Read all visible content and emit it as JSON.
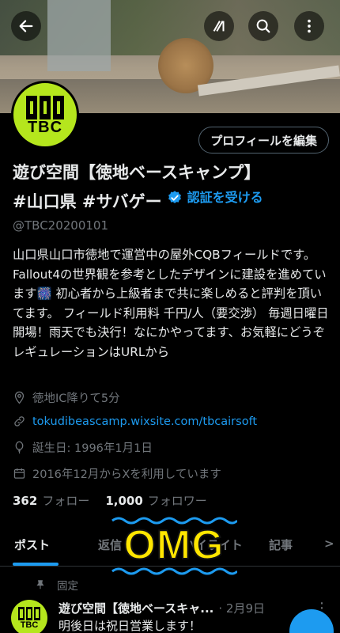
{
  "header": {
    "back_icon": "arrow-left-icon",
    "grok_icon": "grok-icon",
    "search_icon": "search-icon",
    "more_icon": "more-vertical-icon"
  },
  "profile": {
    "avatar_text": "TBC",
    "edit_label": "プロフィールを編集",
    "name_line1": "遊び空間【徳地ベースキャンプ】",
    "name_line2": "#山口県 #サバゲー",
    "verify_label": "認証を受ける",
    "handle": "@TBC20200101",
    "bio": "山口県山口市徳地で運営中の屋外CQBフィールドです。 Fallout4の世界観を参考としたデザインに建設を進めています🎆 初心者から上級者まで共に楽しめると評判を頂いてます。 フィールド利用料 千円/人（要交渉） 毎週日曜日開場！雨天でも決行！なにかやってます、お気軽にどうぞ レギュレーションはURLから",
    "location": "徳地IC降りて5分",
    "website": "tokudibeascamp.wixsite.com/tbcairsoft",
    "birthday": "誕生日: 1996年1月1日",
    "joined": "2016年12月からXを利用しています",
    "following_count": "362",
    "following_label": "フォロー",
    "followers_count": "1,000",
    "followers_label": "フォロワー"
  },
  "tabs": [
    {
      "label": "ポスト",
      "active": true
    },
    {
      "label": "返信"
    },
    {
      "label": "ハイライト"
    },
    {
      "label": "記事"
    },
    {
      "label": ">"
    }
  ],
  "overlay": {
    "text": "OMG",
    "color": "#ffe600",
    "wave_color": "#1d9bf0"
  },
  "pinned_post": {
    "pinned_label": "固定",
    "name": "遊び空間【徳地ベースキャ...",
    "date": "· 2月9日",
    "text": "明後日は祝日営業します！"
  },
  "colors": {
    "accent": "#1d9bf0",
    "brand": "#b5e61d",
    "background": "#000000",
    "muted": "#71767b"
  }
}
